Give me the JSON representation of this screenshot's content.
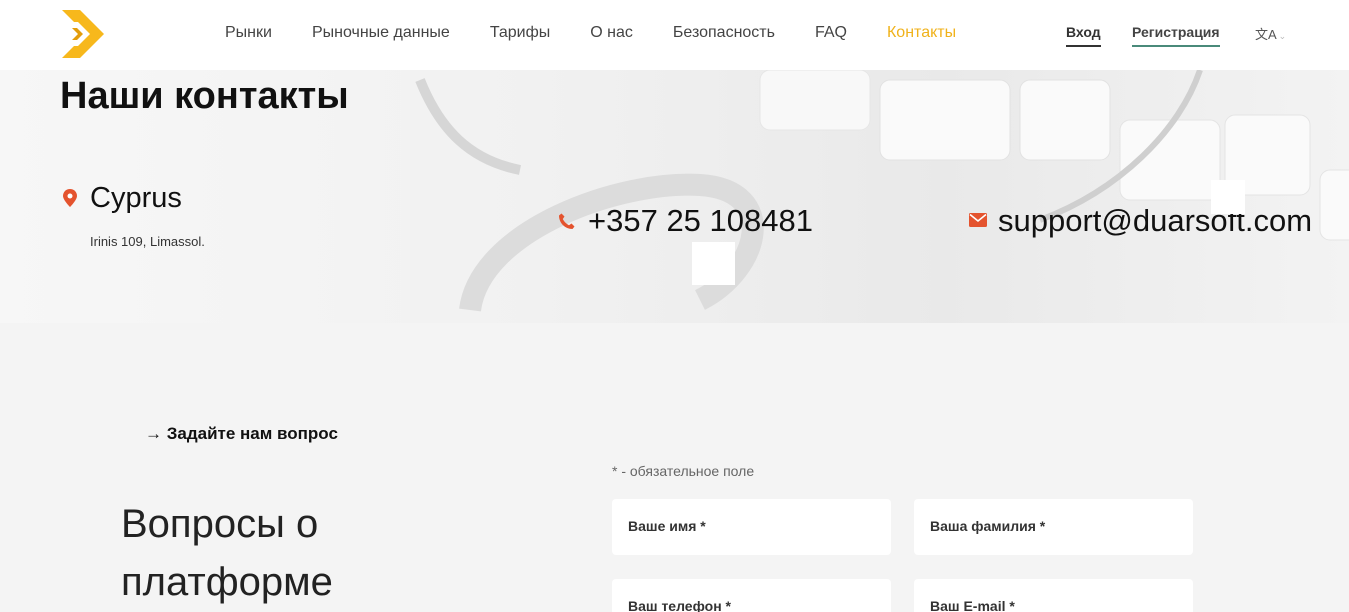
{
  "header": {
    "logo": "duarsoft-logo",
    "nav": [
      "Рынки",
      "Рыночные данные",
      "Тарифы",
      "О нас",
      "Безопасность",
      "FAQ",
      "Контакты"
    ],
    "active_nav": "Контакты",
    "login_label": "Вход",
    "register_label": "Регистрация",
    "lang_icon": "translate-icon",
    "lang_glyph": "文A",
    "caret": "⌄"
  },
  "contacts": {
    "title": "Наши контакты",
    "country": "Cyprus",
    "address": "Irinis 109, Limassol.",
    "phone": "+357 25 108481",
    "email": "support@duarsoft.com",
    "location_icon": "map-pin-icon",
    "phone_icon": "phone-icon",
    "email_icon": "envelope-icon"
  },
  "form": {
    "ask_label": "→ Задайте нам вопрос",
    "section_title": "Вопросы о платформе",
    "required_note": "* - обязательное поле",
    "fields": [
      "Ваше имя *",
      "Ваша фамилия *",
      "Ваш телефон *",
      "Ваш E-mail *"
    ]
  },
  "colors": {
    "accent": "#f0b21b",
    "icon_red": "#e4532e",
    "register_underline": "#4a8a7a"
  }
}
